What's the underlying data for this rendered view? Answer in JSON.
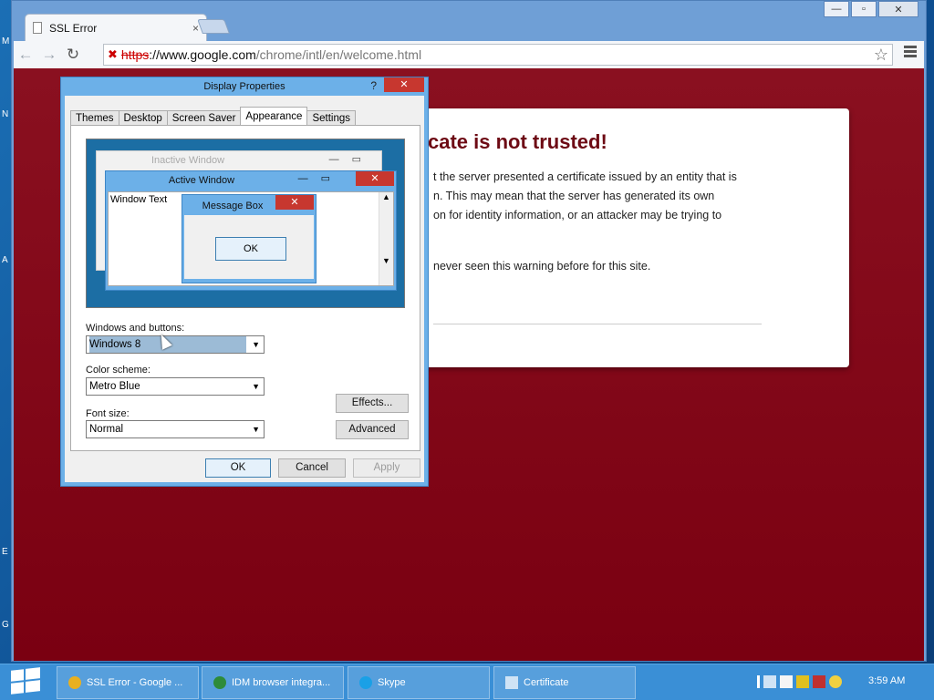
{
  "desktop": {
    "letters": [
      "M",
      "N",
      "A",
      "E",
      "G"
    ]
  },
  "browser": {
    "tab_title": "SSL Error",
    "tab_close": "×",
    "window_controls": {
      "minimize": "—",
      "maximize": "▫",
      "close": "✕"
    },
    "address": {
      "scheme": "https",
      "host": "://www.google.com",
      "path": "/chrome/intl/en/welcome.html"
    },
    "back_icon": "←",
    "forward_icon": "→",
    "reload_icon": "↻",
    "star_icon": "☆"
  },
  "ssl_page": {
    "title": "cate is not trusted!",
    "lines": [
      "t the server presented a certificate issued by an entity that is",
      "n. This may mean that the server has generated its own",
      "on for identity information, or an attacker may be trying to",
      "never seen this warning before for this site."
    ]
  },
  "dialog": {
    "title": "Display Properties",
    "help": "?",
    "close": "✕",
    "tabs": [
      "Themes",
      "Desktop",
      "Screen Saver",
      "Appearance",
      "Settings"
    ],
    "active_tab": "Appearance",
    "preview": {
      "inactive_title": "Inactive Window",
      "active_title": "Active Window",
      "window_text": "Window Text",
      "message_title": "Message Box",
      "message_ok": "OK",
      "controls": "—▭",
      "close": "✕"
    },
    "windows_buttons": {
      "label": "Windows and buttons:",
      "value": "Windows 8"
    },
    "color_scheme": {
      "label": "Color scheme:",
      "value": "Metro Blue"
    },
    "font_size": {
      "label": "Font size:",
      "value": "Normal"
    },
    "effects": "Effects...",
    "advanced": "Advanced",
    "ok": "OK",
    "cancel": "Cancel",
    "apply": "Apply"
  },
  "taskbar": {
    "items": [
      {
        "label": "SSL Error - Google ...",
        "color": "#e8b020"
      },
      {
        "label": "IDM browser integra...",
        "color": "#2e8b3a"
      },
      {
        "label": "Skype",
        "color": "#1aa0e6"
      },
      {
        "label": "Certificate",
        "color": "#cfe3f5"
      }
    ],
    "clock": "3:59 AM"
  }
}
